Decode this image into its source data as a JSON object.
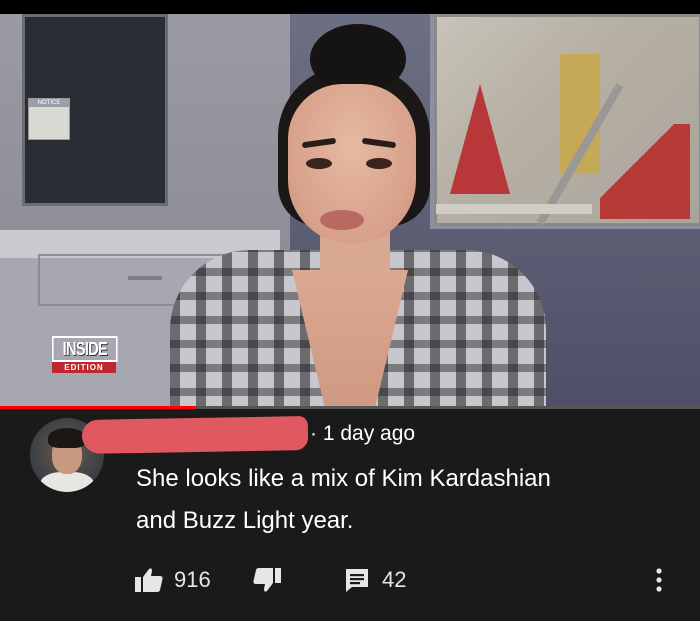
{
  "video": {
    "logo_text": "INSIDE",
    "logo_subtext": "EDITION",
    "progress_fraction": 0.28
  },
  "comment": {
    "meta": "· 1 day ago",
    "text_line1": "She looks like a mix of Kim Kardashian",
    "text_line2": "and Buzz Light year.",
    "like_count": "916",
    "reply_count": "42"
  },
  "icons": {
    "like": "thumb-up-icon",
    "dislike": "thumb-down-icon",
    "reply": "comment-icon",
    "more": "more-vert-icon"
  },
  "colors": {
    "background": "#1a1a1a",
    "progress": "#ff0000",
    "redaction": "#e05860",
    "text": "#ffffff"
  }
}
